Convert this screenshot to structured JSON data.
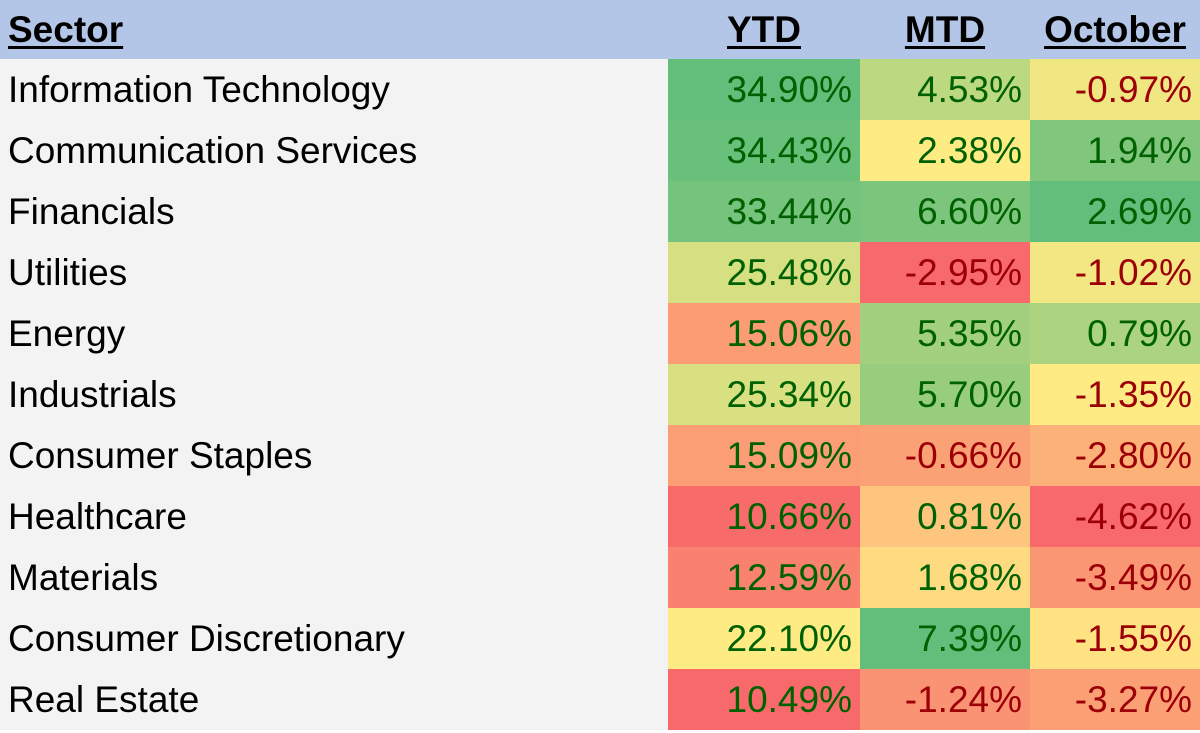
{
  "chart_data": {
    "type": "heatmap",
    "columns": [
      "Sector",
      "YTD",
      "MTD",
      "October"
    ],
    "rows": [
      {
        "sector": "Information Technology",
        "values": [
          "34.90%",
          "4.53%",
          "-0.97%"
        ]
      },
      {
        "sector": "Communication Services",
        "values": [
          "34.43%",
          "2.38%",
          "1.94%"
        ]
      },
      {
        "sector": "Financials",
        "values": [
          "33.44%",
          "6.60%",
          "2.69%"
        ]
      },
      {
        "sector": "Utilities",
        "values": [
          "25.48%",
          "-2.95%",
          "-1.02%"
        ]
      },
      {
        "sector": "Energy",
        "values": [
          "15.06%",
          "5.35%",
          "0.79%"
        ]
      },
      {
        "sector": "Industrials",
        "values": [
          "25.34%",
          "5.70%",
          "-1.35%"
        ]
      },
      {
        "sector": "Consumer Staples",
        "values": [
          "15.09%",
          "-0.66%",
          "-2.80%"
        ]
      },
      {
        "sector": "Healthcare",
        "values": [
          "10.66%",
          "0.81%",
          "-4.62%"
        ]
      },
      {
        "sector": "Materials",
        "values": [
          "12.59%",
          "1.68%",
          "-3.49%"
        ]
      },
      {
        "sector": "Consumer Discretionary",
        "values": [
          "22.10%",
          "7.39%",
          "-1.55%"
        ]
      },
      {
        "sector": "Real Estate",
        "values": [
          "10.49%",
          "-1.24%",
          "-3.27%"
        ]
      }
    ],
    "color_scale": {
      "low": "#f8696b",
      "mid": "#ffeb84",
      "high": "#63be7b"
    },
    "text_colors": {
      "positive": "#006100",
      "negative": "#9c0006"
    },
    "header_color": "#b4c6e7"
  }
}
